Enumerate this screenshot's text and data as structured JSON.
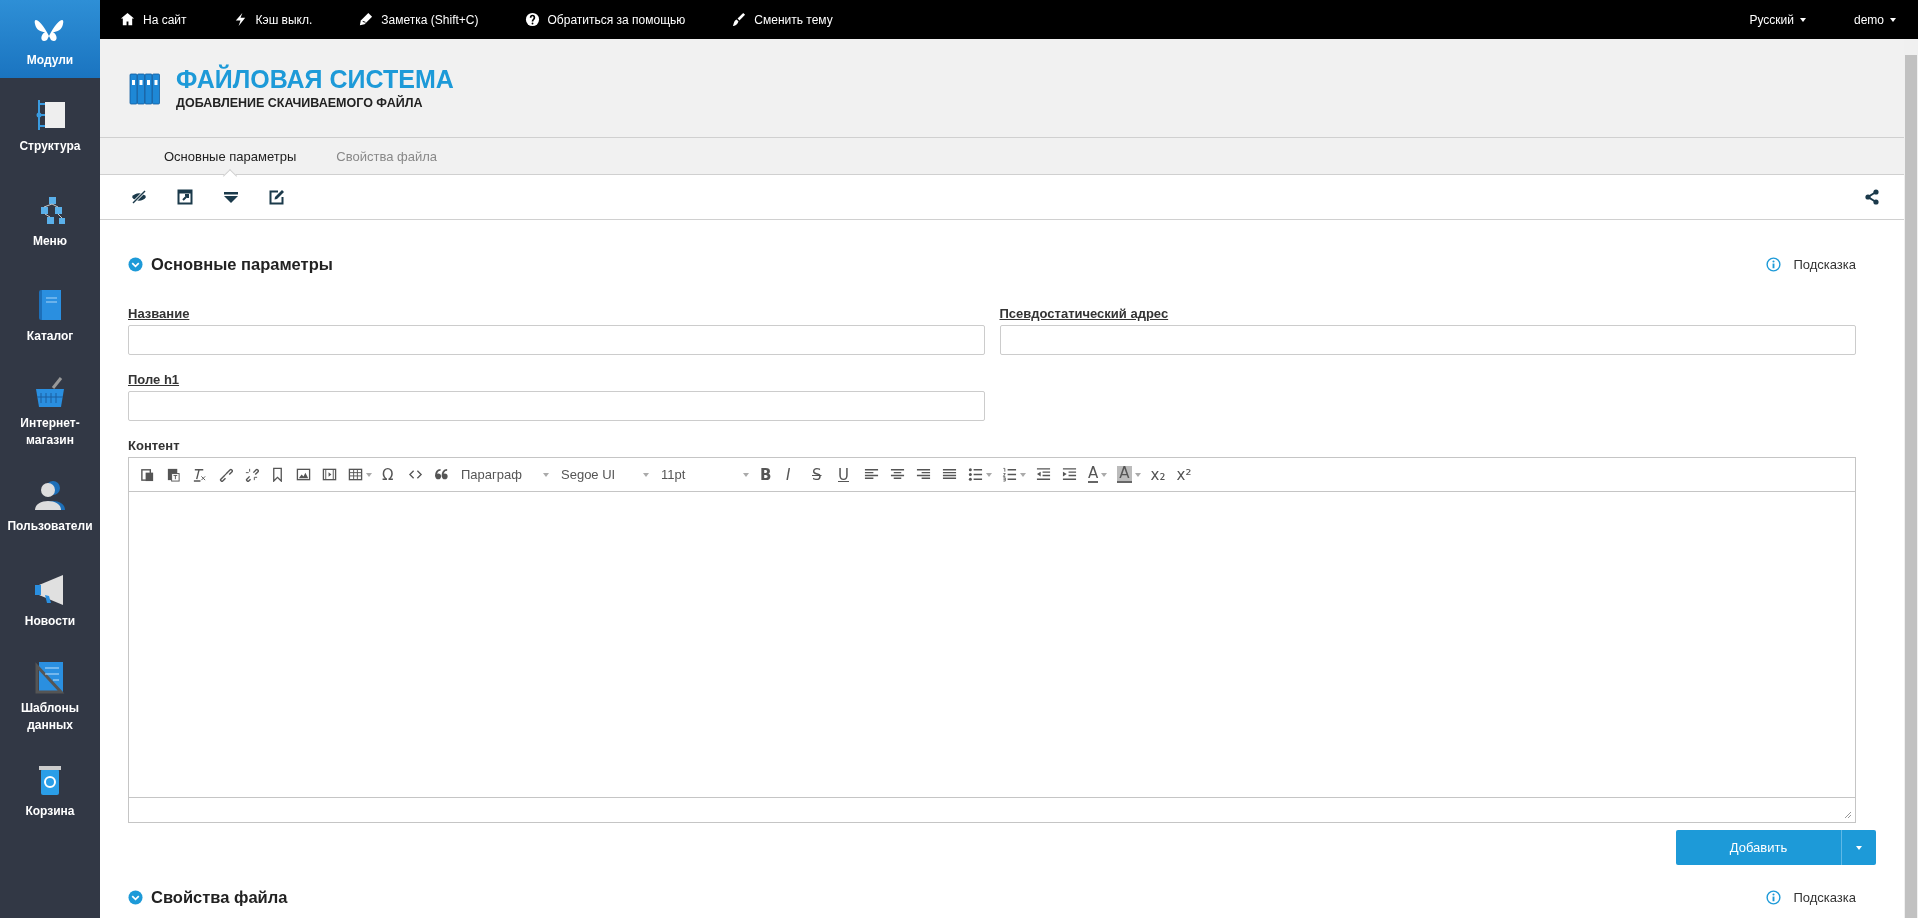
{
  "sidebar": {
    "items": [
      {
        "label": "Модули",
        "selected": true
      },
      {
        "label": "Структура",
        "selected": false
      },
      {
        "label": "Меню",
        "selected": false
      },
      {
        "label": "Каталог",
        "selected": false
      },
      {
        "label": "Интернет-магазин",
        "selected": false
      },
      {
        "label": "Пользователи",
        "selected": false
      },
      {
        "label": "Новости",
        "selected": false
      },
      {
        "label": "Шаблоны данных",
        "selected": false
      },
      {
        "label": "Корзина",
        "selected": false
      }
    ]
  },
  "top_bar": {
    "links": [
      {
        "label": "На сайт"
      },
      {
        "label": "Кэш выкл."
      },
      {
        "label": "Заметка (Shift+C)"
      },
      {
        "label": "Обратиться за помощью"
      },
      {
        "label": "Сменить тему"
      }
    ],
    "language": "Русский",
    "user": "demo"
  },
  "header": {
    "title": "ФАЙЛОВАЯ СИСТЕМА",
    "subtitle": "ДОБАВЛЕНИЕ СКАЧИВАЕМОГО ФАЙЛА"
  },
  "tabs": [
    {
      "label": "Основные параметры",
      "selected": true
    },
    {
      "label": "Свойства файла",
      "selected": false
    }
  ],
  "section_main": {
    "title": "Основные параметры",
    "hint": "Подсказка"
  },
  "fields": [
    {
      "label": "Название"
    },
    {
      "label": "Псевдостатический адрес"
    },
    {
      "label": "Поле h1"
    }
  ],
  "editor": {
    "label": "Контент",
    "toolbar": [
      {
        "kind": "icon"
      },
      {
        "kind": "icon"
      },
      {
        "kind": "icon"
      },
      {
        "kind": "icon"
      },
      {
        "kind": "icon"
      },
      {
        "kind": "icon"
      },
      {
        "kind": "icon"
      },
      {
        "kind": "icon"
      },
      {
        "kind": "icon",
        "menu": true
      },
      {
        "kind": "glyph",
        "text": "Ω"
      },
      {
        "kind": "icon"
      },
      {
        "kind": "icon"
      },
      {
        "kind": "select",
        "text": "Параграф"
      },
      {
        "kind": "select",
        "text": "Segoe UI"
      },
      {
        "kind": "select",
        "text": "11pt"
      },
      {
        "kind": "glyph",
        "text": "B"
      },
      {
        "kind": "glyph",
        "text": "I"
      },
      {
        "kind": "glyph",
        "text": "S"
      },
      {
        "kind": "glyph",
        "text": "U"
      },
      {
        "kind": "icon"
      },
      {
        "kind": "icon"
      },
      {
        "kind": "icon"
      },
      {
        "kind": "icon"
      },
      {
        "kind": "icon",
        "menu": true
      },
      {
        "kind": "icon",
        "menu": true
      },
      {
        "kind": "icon"
      },
      {
        "kind": "icon"
      },
      {
        "kind": "text-color",
        "text": "A",
        "menu": true
      },
      {
        "kind": "highlight-color",
        "text": "A",
        "menu": true
      },
      {
        "kind": "glyph",
        "text": "x₂"
      },
      {
        "kind": "glyph",
        "text": "x²"
      }
    ]
  },
  "submit": {
    "label": "Добавить"
  },
  "section_file": {
    "title": "Свойства файла",
    "hint": "Подсказка"
  }
}
